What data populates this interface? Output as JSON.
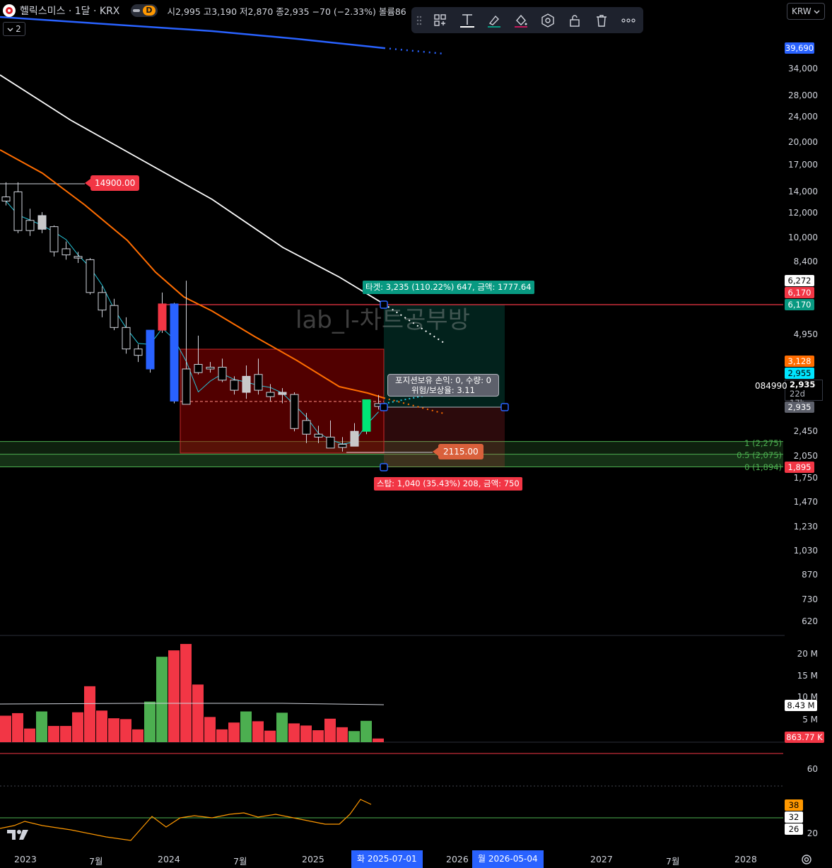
{
  "header": {
    "symbol": "헬릭스미스 · 1달 · KRX",
    "badge": "D",
    "ohlc": "시2,995 고3,190 저2,870 종2,935 −70 (−2.33%) 볼륨86",
    "indicator_count": "2"
  },
  "currency": "KRW",
  "colors": {
    "up": "#26a69a",
    "down": "#f23645",
    "accent_blue": "#2962ff",
    "target_green": "#089981"
  },
  "toolbar": {
    "icons": [
      "drag-handle-icon",
      "template-icon",
      "text-icon",
      "brush-icon",
      "fill-icon",
      "settings-hexagon-icon",
      "lock-icon",
      "trash-icon",
      "more-icon"
    ]
  },
  "price_axis": {
    "labels": [
      "34,000",
      "28,000",
      "24,000",
      "20,000",
      "17,000",
      "14,000",
      "12,000",
      "10,000",
      "8,400",
      "4,950",
      "2,450",
      "2,050",
      "1,750",
      "1,470",
      "1,230",
      "1,030",
      "870",
      "730",
      "620"
    ]
  },
  "price_badges": {
    "blue_top": "39,690",
    "p6272": "6,272",
    "p6170_red": "6,170",
    "p6170_teal": "6,170",
    "p3128": "3,128",
    "p2955": "2,955",
    "last_price": "2,935",
    "countdown": "22d 17h",
    "p2935_grey": "2,935",
    "p1895": "1,895"
  },
  "volume_axis": {
    "labels": [
      "20 M",
      "15 M",
      "10 M",
      "5 M"
    ],
    "badge_ma": "8.43 M",
    "badge_last": "863.77 K"
  },
  "osc_axis": {
    "labels": [
      "60",
      "20"
    ],
    "badge_38": "38",
    "badge_32": "32",
    "badge_26": "26"
  },
  "code_label": "084990",
  "watermark": "lab_l-차트공부방",
  "annotations": {
    "high_label": "14900.00",
    "low_label": "2115.00",
    "target": "타겟: 3,235 (110.22%) 647, 금액: 1777.64",
    "stop": "스탑: 1,040 (35.43%) 208, 금액: 750",
    "position_line1": "포지션보유 손익: 0, 수량: 0",
    "position_line2": "위험/보상율: 3.11"
  },
  "fib": {
    "level_1": "1 (2,275)",
    "level_05": "0.5 (2,075)",
    "level_0": "0 (1,894)"
  },
  "time_axis": {
    "labels": [
      "2023",
      "7월",
      "2024",
      "7월",
      "2025",
      "2026",
      "2027",
      "7월",
      "2028"
    ],
    "highlight_start": "화 2025-07-01",
    "highlight_end": "월 2026-05-04"
  },
  "chart_data": {
    "type": "candlestick",
    "timeframe": "1M",
    "candles": [
      {
        "o": 13400,
        "h": 14900,
        "l": 12600,
        "c": 13000
      },
      {
        "o": 13900,
        "h": 14900,
        "l": 10300,
        "c": 10500
      },
      {
        "o": 11300,
        "h": 12300,
        "l": 10100,
        "c": 10500
      },
      {
        "o": 10600,
        "h": 12000,
        "l": 10300,
        "c": 11700
      },
      {
        "o": 10800,
        "h": 10900,
        "l": 8700,
        "c": 9000
      },
      {
        "o": 9200,
        "h": 9700,
        "l": 8500,
        "c": 8800
      },
      {
        "o": 8700,
        "h": 9000,
        "l": 8300,
        "c": 8600
      },
      {
        "o": 8500,
        "h": 8600,
        "l": 6600,
        "c": 6700
      },
      {
        "o": 6700,
        "h": 7000,
        "l": 5600,
        "c": 5900
      },
      {
        "o": 6100,
        "h": 6400,
        "l": 5100,
        "c": 5200
      },
      {
        "o": 5200,
        "h": 5600,
        "l": 4300,
        "c": 4450
      },
      {
        "o": 4450,
        "h": 4600,
        "l": 4050,
        "c": 4250
      },
      {
        "o": 3850,
        "h": 4750,
        "l": 3750,
        "c": 5100
      },
      {
        "o": 5100,
        "h": 6700,
        "l": 5000,
        "c": 6170
      },
      {
        "o": 6170,
        "h": 6220,
        "l": 3000,
        "c": 3050
      },
      {
        "o": 3850,
        "h": 7300,
        "l": 3050,
        "c": 2980
      },
      {
        "o": 3980,
        "h": 4900,
        "l": 3700,
        "c": 3750
      },
      {
        "o": 3900,
        "h": 4050,
        "l": 3750,
        "c": 3850
      },
      {
        "o": 3900,
        "h": 4150,
        "l": 3500,
        "c": 3550
      },
      {
        "o": 3550,
        "h": 3650,
        "l": 3200,
        "c": 3300
      },
      {
        "o": 3250,
        "h": 3950,
        "l": 3100,
        "c": 3650
      },
      {
        "o": 3700,
        "h": 4150,
        "l": 3200,
        "c": 3300
      },
      {
        "o": 3250,
        "h": 3450,
        "l": 3050,
        "c": 3150
      },
      {
        "o": 3200,
        "h": 3350,
        "l": 3000,
        "c": 3250
      },
      {
        "o": 3200,
        "h": 3250,
        "l": 2450,
        "c": 2500
      },
      {
        "o": 2650,
        "h": 2800,
        "l": 2250,
        "c": 2400
      },
      {
        "o": 2400,
        "h": 2550,
        "l": 2250,
        "c": 2350
      },
      {
        "o": 2350,
        "h": 2650,
        "l": 2200,
        "c": 2170
      },
      {
        "o": 2230,
        "h": 2350,
        "l": 2115,
        "c": 2180
      },
      {
        "o": 2200,
        "h": 2600,
        "l": 2200,
        "c": 2450
      },
      {
        "o": 2450,
        "h": 3050,
        "l": 2400,
        "c": 3080
      },
      {
        "o": 2995,
        "h": 3190,
        "l": 2870,
        "c": 2935
      }
    ],
    "volume": [
      6.2,
      6.8,
      3.2,
      7.2,
      3.8,
      3.8,
      7.0,
      13.1,
      7.4,
      5.6,
      5.4,
      3.0,
      9.5,
      20.0,
      21.5,
      23.0,
      13.5,
      5.9,
      3.0,
      4.6,
      7.2,
      4.9,
      2.7,
      6.9,
      4.4,
      3.9,
      2.8,
      5.5,
      3.5,
      2.6,
      5.0,
      0.86
    ],
    "volume_ma": 8.43,
    "oscillator_levels": [
      38,
      32,
      26
    ],
    "fib_levels": [
      {
        "ratio": 1,
        "price": 2275
      },
      {
        "ratio": 0.5,
        "price": 2075
      },
      {
        "ratio": 0,
        "price": 1894
      }
    ],
    "position": {
      "entry": 2935,
      "target": 6170,
      "stop": 1895,
      "risk_reward": 3.11
    }
  }
}
